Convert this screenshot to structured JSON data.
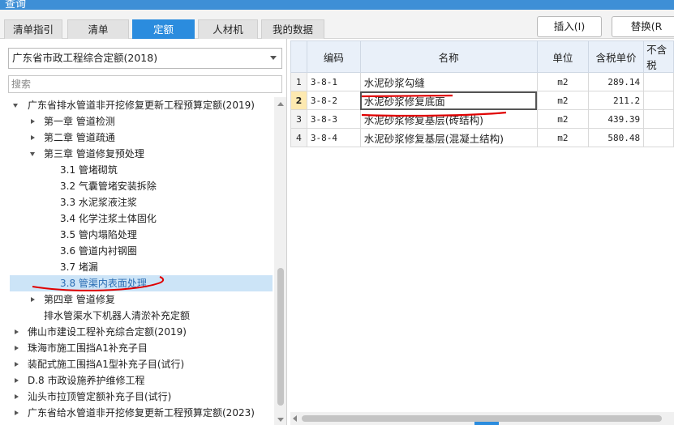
{
  "window": {
    "title": "查询"
  },
  "tabs": [
    {
      "label": "清单指引",
      "active": false
    },
    {
      "label": "清单",
      "active": false
    },
    {
      "label": "定额",
      "active": true
    },
    {
      "label": "人材机",
      "active": false
    },
    {
      "label": "我的数据",
      "active": false
    }
  ],
  "toolbar": {
    "insert_label": "插入(I)",
    "replace_label": "替换(R"
  },
  "library": {
    "selected": "广东省市政工程综合定额(2018)"
  },
  "search": {
    "placeholder": "搜索",
    "value": ""
  },
  "tree": [
    {
      "label": "广东省排水管道非开挖修复更新工程预算定额(2019)",
      "level": 0,
      "toggle": "down"
    },
    {
      "label": "第一章 管道检测",
      "level": 1,
      "toggle": "right"
    },
    {
      "label": "第二章 管道疏通",
      "level": 1,
      "toggle": "right"
    },
    {
      "label": "第三章 管道修复预处理",
      "level": 1,
      "toggle": "down"
    },
    {
      "label": "3.1 管堵砌筑",
      "level": 2,
      "toggle": ""
    },
    {
      "label": "3.2 气囊管堵安装拆除",
      "level": 2,
      "toggle": ""
    },
    {
      "label": "3.3 水泥浆液注浆",
      "level": 2,
      "toggle": ""
    },
    {
      "label": "3.4 化学注浆土体固化",
      "level": 2,
      "toggle": ""
    },
    {
      "label": "3.5 管内塌陷处理",
      "level": 2,
      "toggle": ""
    },
    {
      "label": "3.6 管道内衬钢圈",
      "level": 2,
      "toggle": ""
    },
    {
      "label": "3.7 堵漏",
      "level": 2,
      "toggle": ""
    },
    {
      "label": "3.8 管渠内表面处理",
      "level": 2,
      "toggle": "",
      "selected": true
    },
    {
      "label": "第四章 管道修复",
      "level": 1,
      "toggle": "right"
    },
    {
      "label": "排水管渠水下机器人清淤补充定额",
      "level": 1,
      "toggle": ""
    },
    {
      "label": "佛山市建设工程补充综合定额(2019)",
      "level": 0,
      "toggle": "right"
    },
    {
      "label": "珠海市施工围挡A1补充子目",
      "level": 0,
      "toggle": "right"
    },
    {
      "label": "装配式施工围挡A1型补充子目(试行)",
      "level": 0,
      "toggle": "right"
    },
    {
      "label": "D.8 市政设施养护维修工程",
      "level": 0,
      "toggle": "right"
    },
    {
      "label": "汕头市拉顶管定额补充子目(试行)",
      "level": 0,
      "toggle": "right"
    },
    {
      "label": "广东省给水管道非开挖修复更新工程预算定额(2023)",
      "level": 0,
      "toggle": "right"
    }
  ],
  "grid": {
    "headers": [
      "",
      "编码",
      "名称",
      "单位",
      "含税单价",
      "不含税"
    ],
    "rows": [
      {
        "idx": "1",
        "code": "3-8-1",
        "name": "水泥砂浆勾缝",
        "unit": "m2",
        "price": "289.14"
      },
      {
        "idx": "2",
        "code": "3-8-2",
        "name": "水泥砂浆修复底面",
        "unit": "m2",
        "price": "211.2",
        "current": true
      },
      {
        "idx": "3",
        "code": "3-8-3",
        "name": "水泥砂浆修复基层(砖结构)",
        "unit": "m2",
        "price": "439.39"
      },
      {
        "idx": "4",
        "code": "3-8-4",
        "name": "水泥砂浆修复基层(混凝土结构)",
        "unit": "m2",
        "price": "580.48"
      }
    ]
  },
  "colors": {
    "accent": "#2b8cde",
    "annotation": "#e00000",
    "selection": "#cce4f7"
  },
  "icons": {
    "dropdown": "chevron-down-icon",
    "expand": "triangle-right-icon",
    "collapse": "triangle-down-icon"
  }
}
